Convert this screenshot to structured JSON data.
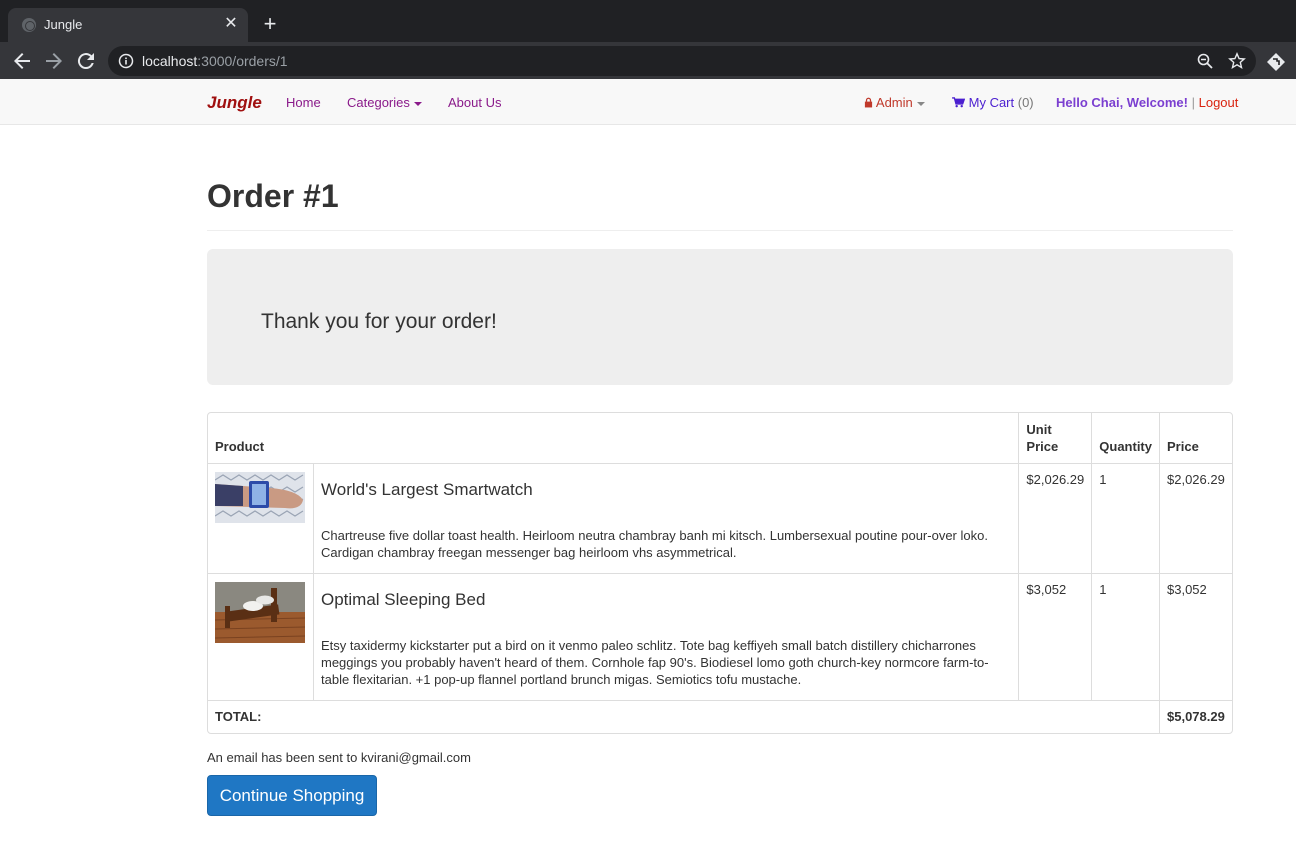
{
  "browser": {
    "tab_title": "Jungle",
    "url_host": "localhost",
    "url_rest": ":3000/orders/1"
  },
  "navbar": {
    "brand": "Jungle",
    "links": {
      "home": "Home",
      "categories": "Categories",
      "about": "About Us"
    },
    "admin": "Admin",
    "cart_label": "My Cart",
    "cart_count": "(0)",
    "greeting": "Hello Chai, Welcome!",
    "separator": "|",
    "logout": "Logout"
  },
  "page": {
    "title": "Order #1",
    "thank_you": "Thank you for your order!"
  },
  "table": {
    "headers": {
      "product": "Product",
      "unit_price": "Unit Price",
      "quantity": "Quantity",
      "price": "Price"
    },
    "rows": [
      {
        "name": "World's Largest Smartwatch",
        "description": "Chartreuse five dollar toast health. Heirloom neutra chambray banh mi kitsch. Lumbersexual poutine pour-over loko. Cardigan chambray freegan messenger bag heirloom vhs asymmetrical.",
        "unit_price": "$2,026.29",
        "quantity": "1",
        "price": "$2,026.29"
      },
      {
        "name": "Optimal Sleeping Bed",
        "description": "Etsy taxidermy kickstarter put a bird on it venmo paleo schlitz. Tote bag keffiyeh small batch distillery chicharrones meggings you probably haven't heard of them. Cornhole fap 90's. Biodiesel lomo goth church-key normcore farm-to-table flexitarian. +1 pop-up flannel portland brunch migas. Semiotics tofu mustache.",
        "unit_price": "$3,052",
        "quantity": "1",
        "price": "$3,052"
      }
    ],
    "total_label": "TOTAL:",
    "total_value": "$5,078.29"
  },
  "footer": {
    "email_note": "An email has been sent to kvirani@gmail.com",
    "continue_button": "Continue Shopping"
  },
  "colors": {
    "brand": "#a01010",
    "nav_link": "#8a1a8a",
    "primary_button": "#1f77c4"
  }
}
